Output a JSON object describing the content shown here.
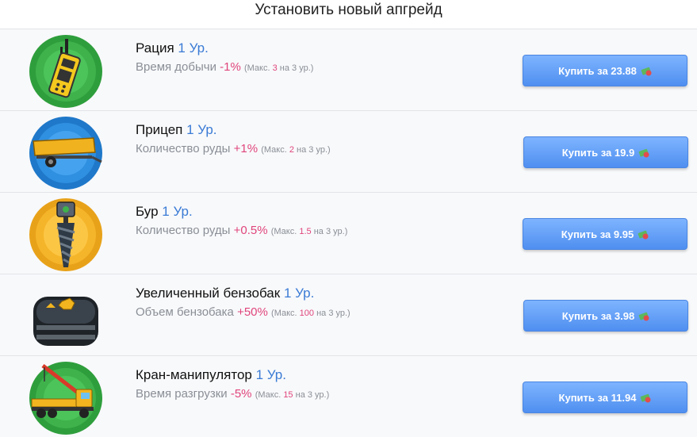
{
  "header": {
    "title": "Установить новый апгрейд"
  },
  "upgrades": [
    {
      "name": "Рация",
      "level": "1 Ур.",
      "stat": "Время добычи",
      "value": "-1%",
      "note_prefix": "(Макс.",
      "note_max": "3",
      "note_suffix": "на 3 ур.)",
      "button": "Купить за 23.88",
      "icon": "walkie-talkie-icon",
      "circle_color": "#3aa845"
    },
    {
      "name": "Прицеп",
      "level": "1 Ур.",
      "stat": "Количество руды",
      "value": "+1%",
      "note_prefix": "(Макс.",
      "note_max": "2",
      "note_suffix": "на 3 ур.)",
      "button": "Купить за 19.9",
      "icon": "trailer-icon",
      "circle_color": "#2f8fe0"
    },
    {
      "name": "Бур",
      "level": "1 Ур.",
      "stat": "Количество руды",
      "value": "+0.5%",
      "note_prefix": "(Макс.",
      "note_max": "1.5",
      "note_suffix": "на 3 ур.)",
      "button": "Купить за 9.95",
      "icon": "drill-icon",
      "circle_color": "#f5b52a"
    },
    {
      "name": "Увеличенный бензобак",
      "level": "1 Ур.",
      "stat": "Объем бензобака",
      "value": "+50%",
      "note_prefix": "(Макс.",
      "note_max": "100",
      "note_suffix": "на 3 ур.)",
      "button": "Купить за 3.98",
      "icon": "fuel-tank-icon",
      "circle_color": "#333a42"
    },
    {
      "name": "Кран-манипулятор",
      "level": "1 Ур.",
      "stat": "Время разгрузки",
      "value": "-5%",
      "note_prefix": "(Макс.",
      "note_max": "15",
      "note_suffix": "на 3 ур.)",
      "button": "Купить за 11.94",
      "icon": "crane-truck-icon",
      "circle_color": "#3aa845"
    }
  ]
}
